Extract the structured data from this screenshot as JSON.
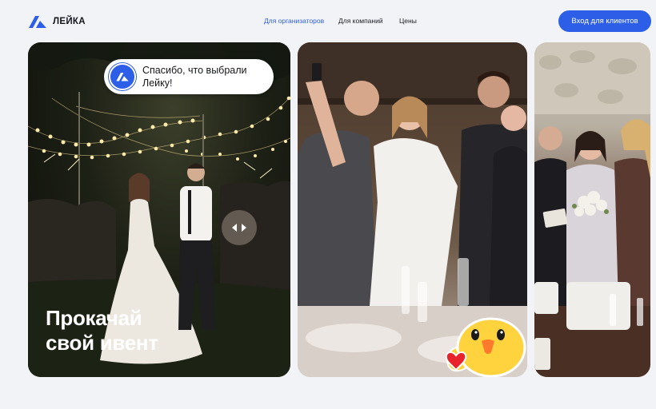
{
  "header": {
    "logo_text": "ЛЕЙКА",
    "logo_icon": "leika-logo-icon",
    "nav": [
      {
        "label": "Для организаторов",
        "active": true
      },
      {
        "label": "Для компаний",
        "active": false
      },
      {
        "label": "Цены",
        "active": false
      }
    ],
    "login_label": "Вход для клиентов"
  },
  "hero": {
    "toast_text": "Спасибо, что выбрали Лейку!",
    "headline_line1": "Прокачай",
    "headline_line2": "свой ивент",
    "slider_icon": "arrows-left-right-icon",
    "sticker_icon": "duck-sticker-icon"
  },
  "colors": {
    "accent": "#2c5ee8",
    "background": "#f2f3f7",
    "text": "#14151a"
  }
}
